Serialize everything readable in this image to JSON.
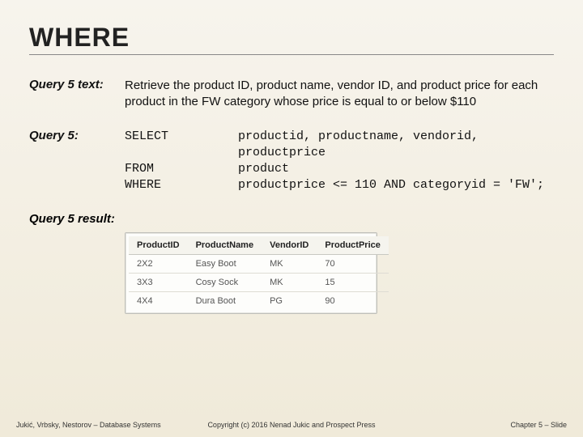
{
  "title": "WHERE",
  "query_text_label": "Query 5 text:",
  "query_text": "Retrieve the product ID, product name, vendor ID, and product price for each product in the FW category whose price is equal to or below $110",
  "query_label": "Query 5:",
  "sql": {
    "kw_select": "SELECT",
    "kw_from": "FROM",
    "kw_where": "WHERE",
    "select_cols": "productid, productname, vendorid, productprice",
    "from_body": "product",
    "where_body": "productprice <= 110 AND categoryid = 'FW';"
  },
  "result_label": "Query 5 result:",
  "chart_data": {
    "type": "table",
    "columns": [
      "ProductID",
      "ProductName",
      "VendorID",
      "ProductPrice"
    ],
    "rows": [
      [
        "2X2",
        "Easy Boot",
        "MK",
        "70"
      ],
      [
        "3X3",
        "Cosy Sock",
        "MK",
        "15"
      ],
      [
        "4X4",
        "Dura Boot",
        "PG",
        "90"
      ]
    ]
  },
  "footer": {
    "left": "Jukić, Vrbsky, Nestorov – Database Systems",
    "center": "Copyright (c) 2016 Nenad Jukic and Prospect Press",
    "right": "Chapter 5 – Slide"
  }
}
